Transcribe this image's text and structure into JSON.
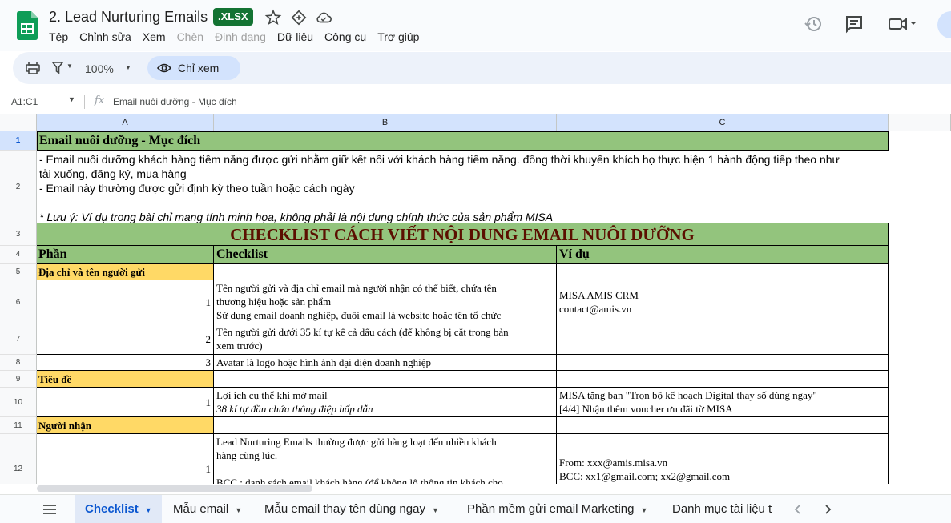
{
  "doc": {
    "title": "2. Lead Nurturing Emails",
    "badge": ".XLSX"
  },
  "menu": {
    "items": [
      "Tệp",
      "Chỉnh sửa",
      "Xem",
      "Chèn",
      "Định dạng",
      "Dữ liệu",
      "Công cụ",
      "Trợ giúp"
    ]
  },
  "toolbar": {
    "zoom": "100%",
    "view_mode": "Chỉ xem"
  },
  "formula_bar": {
    "cell_ref": "A1:C1",
    "fx": "fx",
    "content": "Email nuôi dưỡng - Mục đích"
  },
  "grid": {
    "columns": [
      "A",
      "B",
      "C"
    ],
    "rows": [
      "1",
      "2",
      "3",
      "4",
      "5",
      "6",
      "7",
      "8",
      "9",
      "10",
      "11",
      "12"
    ],
    "r1": "Email nuôi dưỡng - Mục đích",
    "r2": {
      "line1": "- Email nuôi dưỡng khách hàng tiềm năng được gửi nhằm giữ kết nối với khách hàng tiềm năng. đồng thời khuyến khích họ thực hiện 1 hành động tiếp theo như",
      "line2": "tải xuống, đăng ký, mua hàng",
      "line3": "- Email này thường được gửi định kỳ theo tuần hoặc cách ngày",
      "note": "* Lưu ý: Ví dụ trong bài chỉ mang tính minh họa, không phải là nội dung chính thức của sản phẩm MISA"
    },
    "r3": "CHECKLIST CÁCH VIẾT NỘI DUNG EMAIL NUÔI DƯỠNG",
    "r4": {
      "a": "Phần",
      "b": "Checklist",
      "c": "Ví dụ"
    },
    "r5": "Địa chỉ và tên người gửi",
    "r6": {
      "num": "1",
      "b1": "Tên người gửi và địa chỉ email mà người nhận có thể biết, chứa tên",
      "b2": "thương hiệu hoặc sản phẩm",
      "b3": "Sử dụng email doanh nghiệp, đuôi email là website hoặc tên tổ chức",
      "c1": "MISA AMIS CRM",
      "c2": "contact@amis.vn"
    },
    "r7": {
      "num": "2",
      "b1": "Tên người gửi dưới 35 kí tự kể cả dấu cách (để không bị cắt trong bản",
      "b2": "xem trước)"
    },
    "r8": {
      "num": "3",
      "b1": "Avatar là logo hoặc hình ảnh đại diện doanh nghiệp"
    },
    "r9": "Tiêu đề",
    "r10": {
      "num": "1",
      "b1": "Lợi ích cụ thể khi mở mail",
      "b2": "38 kí tự đầu chứa thông điệp hấp dẫn",
      "c1": "MISA tặng bạn \"Trọn bộ kế hoạch Digital thay số dùng ngay\"",
      "c2": "[4/4] Nhận thêm voucher ưu đãi từ MISA"
    },
    "r11": "Người nhận",
    "r12": {
      "num": "1",
      "b1": "Lead Nurturing Emails thường được gửi hàng loạt đến nhiều khách",
      "b2": "hàng cùng lúc.",
      "b3": "BCC : danh sách email khách hàng (để không lộ thông tin khách cho",
      "c1": "From: xxx@amis.misa.vn",
      "c2": "BCC: xx1@gmail.com; xx2@gmail.com"
    }
  },
  "tabs": {
    "items": [
      "Checklist",
      "Mẫu email",
      "Mẫu email thay tên dùng ngay",
      "Phần mềm gửi email Marketing",
      "Danh mục tài liệu t"
    ]
  },
  "colors": {
    "green_fill": "#93c47d",
    "yellow_fill": "#ffd966",
    "title_dark": "#5b0f00",
    "accent_blue": "#0b57d0"
  }
}
